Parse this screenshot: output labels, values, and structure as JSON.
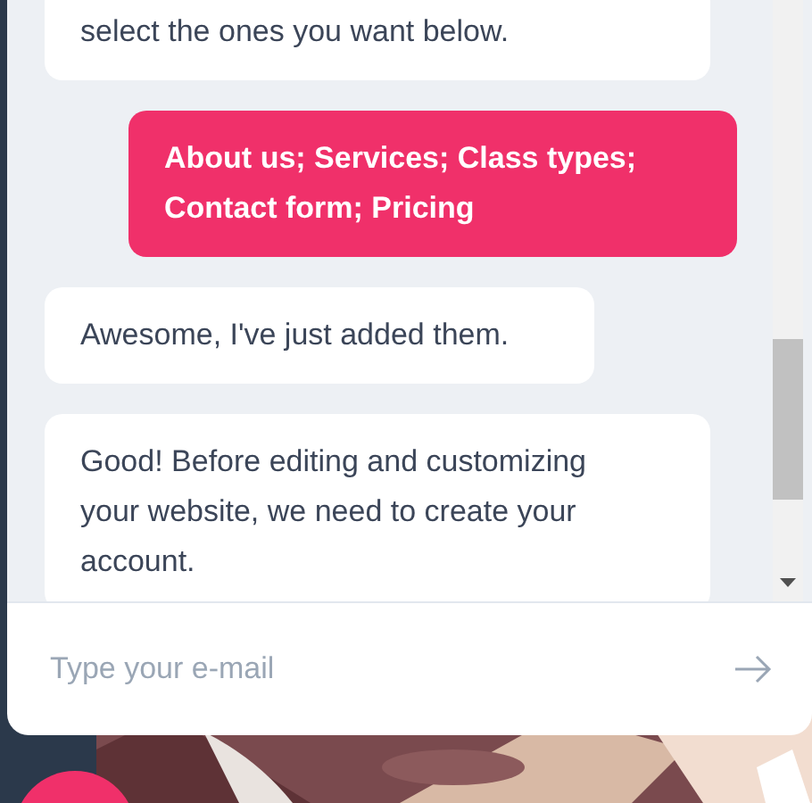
{
  "messages": [
    {
      "kind": "bot",
      "text": "select the ones you want below."
    },
    {
      "kind": "user",
      "text": "About us; Services; Class types; Contact form; Pricing"
    },
    {
      "kind": "bot",
      "text": "Awesome, I've just added them."
    },
    {
      "kind": "bot",
      "text": "Good! Before editing and customizing your website, we need to create your account."
    }
  ],
  "input": {
    "placeholder": "Type your e-mail"
  }
}
